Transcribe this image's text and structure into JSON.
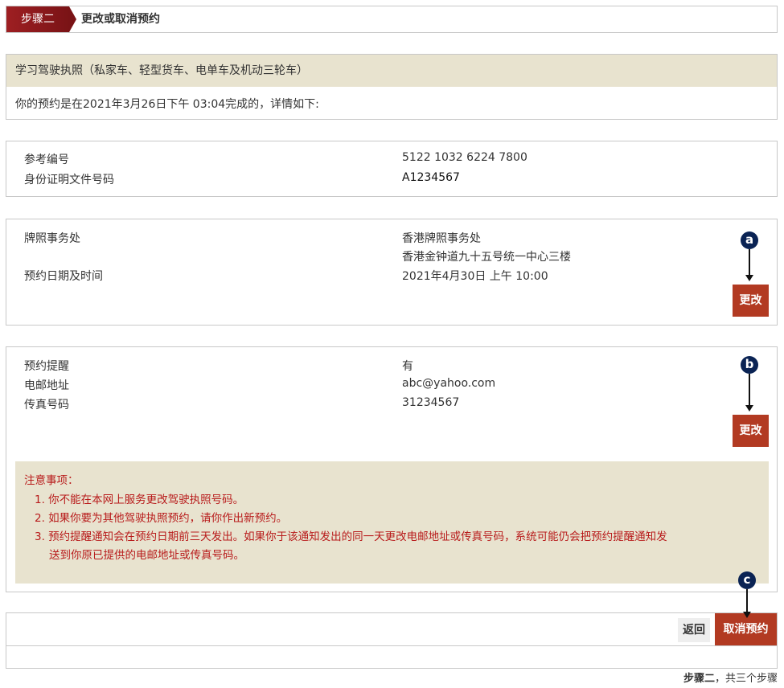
{
  "step": {
    "tag": "步骤二",
    "title": "更改或取消预约"
  },
  "licence": {
    "name": "学习驾驶执照（私家车、轻型货车、电单车及机动三轮车）",
    "completed": "你的预约是在2021年3月26日下午 03:04完成的，详情如下:"
  },
  "reference": {
    "ref_label": "参考编号",
    "ref_value": "5122 1032 6224 7800",
    "id_label": "身份证明文件号码",
    "id_value": "A1234567"
  },
  "office": {
    "office_label": "牌照事务处",
    "office_name": "香港牌照事务处",
    "office_address": "香港金钟道九十五号统一中心三楼",
    "datetime_label": "预约日期及时间",
    "datetime_value": "2021年4月30日 上午 10:00",
    "change_label": "更改"
  },
  "reminder": {
    "reminder_label": "预约提醒",
    "reminder_value": "有",
    "email_label": "电邮地址",
    "email_value": "abc@yahoo.com",
    "fax_label": "传真号码",
    "fax_value": "31234567",
    "change_label": "更改"
  },
  "notice": {
    "title": "注意事项：",
    "items": [
      "1. 你不能在本网上服务更改驾驶执照号码。",
      "2. 如果你要为其他驾驶执照预约，请你作出新预约。",
      "3. 预约提醒通知会在预约日期前三天发出。如果你于该通知发出的同一天更改电邮地址或传真号码，系统可能仍会把预约提醒通知发",
      "送到你原已提供的电邮地址或传真号码。"
    ]
  },
  "actions": {
    "back_label": "返回",
    "cancel_label": "取消预约"
  },
  "footer": {
    "bold": "步骤二",
    "rest": "，共三个步骤"
  },
  "markers": {
    "a": "a",
    "b": "b",
    "c": "c"
  },
  "colors": {
    "brand": "#9e1f22",
    "button": "#b23a22",
    "notice_bg": "#e8e3cf",
    "notice_text": "#b81b1b",
    "marker": "#0a2354"
  }
}
